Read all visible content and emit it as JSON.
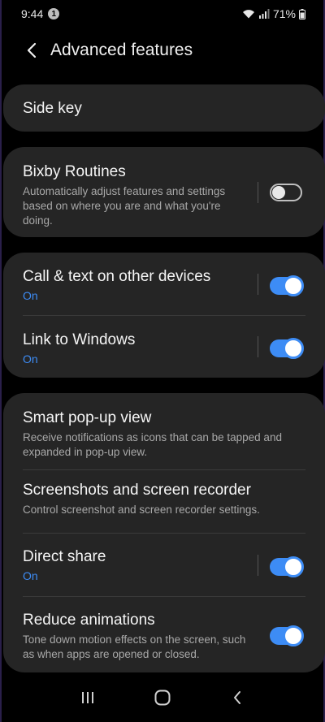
{
  "status": {
    "time": "9:44",
    "notification_count": "1",
    "battery": "71%"
  },
  "header": {
    "title": "Advanced features"
  },
  "side_key": {
    "label": "Side key"
  },
  "bixby": {
    "label": "Bixby Routines",
    "description": "Automatically adjust features and settings based on where you are and what you're doing.",
    "enabled": false
  },
  "call_text": {
    "label": "Call & text on other devices",
    "status": "On",
    "enabled": true
  },
  "link_windows": {
    "label": "Link to Windows",
    "status": "On",
    "enabled": true
  },
  "smart_popup": {
    "label": "Smart pop-up view",
    "description": "Receive notifications as icons that can be tapped and expanded in pop-up view."
  },
  "screenshots": {
    "label": "Screenshots and screen recorder",
    "description": "Control screenshot and screen recorder settings."
  },
  "direct_share": {
    "label": "Direct share",
    "status": "On",
    "enabled": true
  },
  "reduce_animations": {
    "label": "Reduce animations",
    "description": "Tone down motion effects on the screen, such as when apps are opened or closed.",
    "enabled": true
  },
  "colors": {
    "accent": "#3d8cf5",
    "card": "#252525",
    "background": "#000000"
  }
}
